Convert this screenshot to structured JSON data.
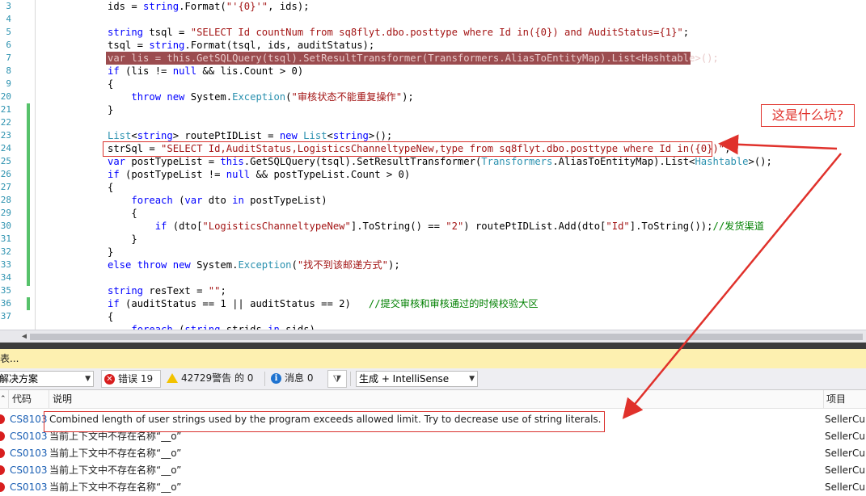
{
  "editor": {
    "line_numbers": [
      "3",
      "4",
      "5",
      "6",
      "7",
      "8",
      "9",
      "20",
      "21",
      "22",
      "23",
      "24",
      "25",
      "26",
      "27",
      "28",
      "29",
      "30",
      "31",
      "32",
      "33",
      "34",
      "35",
      "36",
      "37"
    ],
    "lines": [
      [
        {
          "t": "ids = ",
          "c": ""
        },
        {
          "t": "string",
          "c": "kw"
        },
        {
          "t": ".Format(",
          "c": ""
        },
        {
          "t": "\"'{0}'\"",
          "c": "str"
        },
        {
          "t": ", ids);",
          "c": ""
        }
      ],
      [],
      [
        {
          "t": "string",
          "c": "kw"
        },
        {
          "t": " tsql = ",
          "c": ""
        },
        {
          "t": "\"SELECT Id countNum from sq8flyt.dbo.posttype where Id in({0}) and AuditStatus={1}\"",
          "c": "str"
        },
        {
          "t": ";",
          "c": ""
        }
      ],
      [
        {
          "t": "tsql = ",
          "c": ""
        },
        {
          "t": "string",
          "c": "kw"
        },
        {
          "t": ".Format(tsql, ids, auditStatus);",
          "c": ""
        }
      ],
      [
        {
          "t": "var lis = this.GetSQLQuery(tsql).SetResultTransformer(Transformers.AliasToEntityMap).List<Hashtable>();",
          "c": "hl-text"
        }
      ],
      [
        {
          "t": "if",
          "c": "kw"
        },
        {
          "t": " (lis != ",
          "c": ""
        },
        {
          "t": "null",
          "c": "kw"
        },
        {
          "t": " && lis.Count > 0)",
          "c": ""
        }
      ],
      [
        {
          "t": "{",
          "c": ""
        }
      ],
      [
        {
          "t": "    ",
          "c": ""
        },
        {
          "t": "throw new",
          "c": "kw"
        },
        {
          "t": " System.",
          "c": ""
        },
        {
          "t": "Exception",
          "c": "ty"
        },
        {
          "t": "(",
          "c": ""
        },
        {
          "t": "\"审核状态不能重复操作\"",
          "c": "str"
        },
        {
          "t": ");",
          "c": ""
        }
      ],
      [
        {
          "t": "}",
          "c": ""
        }
      ],
      [],
      [
        {
          "t": "List",
          "c": "ty"
        },
        {
          "t": "<",
          "c": ""
        },
        {
          "t": "string",
          "c": "kw"
        },
        {
          "t": "> routePtIDList = ",
          "c": ""
        },
        {
          "t": "new",
          "c": "kw"
        },
        {
          "t": " ",
          "c": ""
        },
        {
          "t": "List",
          "c": "ty"
        },
        {
          "t": "<",
          "c": ""
        },
        {
          "t": "string",
          "c": "kw"
        },
        {
          "t": ">();",
          "c": ""
        }
      ],
      [
        {
          "t": "strSql = ",
          "c": ""
        },
        {
          "t": "\"SELECT Id,AuditStatus,LogisticsChanneltypeNew,type from sq8flyt.dbo.posttype where Id in({0})\"",
          "c": "str"
        },
        {
          "t": ";",
          "c": ""
        }
      ],
      [
        {
          "t": "var",
          "c": "kw"
        },
        {
          "t": " postTypeList = ",
          "c": ""
        },
        {
          "t": "this",
          "c": "kw"
        },
        {
          "t": ".GetSQLQuery(tsql).SetResultTransformer(",
          "c": ""
        },
        {
          "t": "Transformers",
          "c": "ty"
        },
        {
          "t": ".AliasToEntityMap).List<",
          "c": ""
        },
        {
          "t": "Hashtable",
          "c": "ty"
        },
        {
          "t": ">();",
          "c": ""
        }
      ],
      [
        {
          "t": "if",
          "c": "kw"
        },
        {
          "t": " (postTypeList != ",
          "c": ""
        },
        {
          "t": "null",
          "c": "kw"
        },
        {
          "t": " && postTypeList.Count > 0)",
          "c": ""
        }
      ],
      [
        {
          "t": "{",
          "c": ""
        }
      ],
      [
        {
          "t": "    ",
          "c": ""
        },
        {
          "t": "foreach",
          "c": "kw"
        },
        {
          "t": " (",
          "c": ""
        },
        {
          "t": "var",
          "c": "kw"
        },
        {
          "t": " dto ",
          "c": ""
        },
        {
          "t": "in",
          "c": "kw"
        },
        {
          "t": " postTypeList)",
          "c": ""
        }
      ],
      [
        {
          "t": "    {",
          "c": ""
        }
      ],
      [
        {
          "t": "        ",
          "c": ""
        },
        {
          "t": "if",
          "c": "kw"
        },
        {
          "t": " (dto[",
          "c": ""
        },
        {
          "t": "\"LogisticsChanneltypeNew\"",
          "c": "str"
        },
        {
          "t": "].ToString() == ",
          "c": ""
        },
        {
          "t": "\"2\"",
          "c": "str"
        },
        {
          "t": ") routePtIDList.Add(dto[",
          "c": ""
        },
        {
          "t": "\"Id\"",
          "c": "str"
        },
        {
          "t": "].ToString());",
          "c": ""
        },
        {
          "t": "//发货渠道",
          "c": "cm"
        }
      ],
      [
        {
          "t": "    }",
          "c": ""
        }
      ],
      [
        {
          "t": "}",
          "c": ""
        }
      ],
      [
        {
          "t": "else",
          "c": "kw"
        },
        {
          "t": " ",
          "c": ""
        },
        {
          "t": "throw new",
          "c": "kw"
        },
        {
          "t": " System.",
          "c": ""
        },
        {
          "t": "Exception",
          "c": "ty"
        },
        {
          "t": "(",
          "c": ""
        },
        {
          "t": "\"找不到该邮递方式\"",
          "c": "str"
        },
        {
          "t": ");",
          "c": ""
        }
      ],
      [],
      [
        {
          "t": "string",
          "c": "kw"
        },
        {
          "t": " resText = ",
          "c": ""
        },
        {
          "t": "\"\"",
          "c": "str"
        },
        {
          "t": ";",
          "c": ""
        }
      ],
      [
        {
          "t": "if",
          "c": "kw"
        },
        {
          "t": " (auditStatus == 1 || auditStatus == 2)   ",
          "c": ""
        },
        {
          "t": "//提交审核和审核通过的时候校验大区",
          "c": "cm"
        }
      ],
      [
        {
          "t": "{",
          "c": ""
        }
      ],
      [
        {
          "t": "    ",
          "c": ""
        },
        {
          "t": "foreach",
          "c": "kw"
        },
        {
          "t": " (",
          "c": ""
        },
        {
          "t": "string",
          "c": "kw"
        },
        {
          "t": " strids ",
          "c": ""
        },
        {
          "t": "in",
          "c": "kw"
        },
        {
          "t": " sids)",
          "c": ""
        }
      ]
    ]
  },
  "callout": {
    "text": "这是什么坑?"
  },
  "panel": {
    "title": "表..."
  },
  "toolbar": {
    "scope": "解决方案",
    "errors": "错误 19",
    "warnings": "42729警告 的 0",
    "messages": "消息 0",
    "build_filter": "生成 + IntelliSense"
  },
  "grid": {
    "headers": {
      "code": "代码",
      "desc": "说明",
      "project": "项目"
    },
    "rows": [
      {
        "code": "CS8103",
        "desc": "Combined length of user strings used by the program exceeds allowed limit. Try to decrease use of string literals.",
        "project": "SellerCub"
      },
      {
        "code": "CS0103",
        "desc": "当前上下文中不存在名称“__o”",
        "project": "SellerCub"
      },
      {
        "code": "CS0103",
        "desc": "当前上下文中不存在名称“__o”",
        "project": "SellerCub"
      },
      {
        "code": "CS0103",
        "desc": "当前上下文中不存在名称“__o”",
        "project": "SellerCub"
      },
      {
        "code": "CS0103",
        "desc": "当前上下文中不存在名称“__o”",
        "project": "SellerCub"
      }
    ]
  },
  "colors": {
    "arrow": "#e0312b",
    "highlight": "#9b4c4f",
    "change_bar": "#57c26b"
  }
}
